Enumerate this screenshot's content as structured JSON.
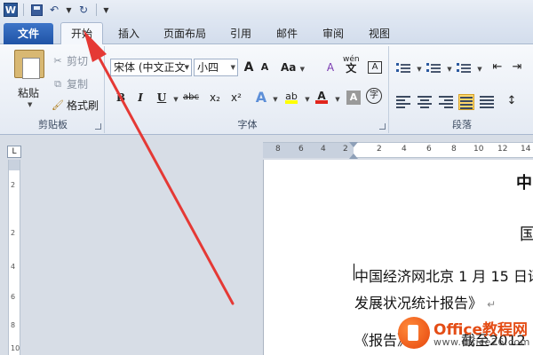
{
  "quick_access": {
    "app_letter": "W"
  },
  "tabs": {
    "file": "文件",
    "home": "开始",
    "insert": "插入",
    "page_layout": "页面布局",
    "references": "引用",
    "mailings": "邮件",
    "review": "审阅",
    "view": "视图"
  },
  "clipboard": {
    "paste": "粘贴",
    "cut": "剪切",
    "copy": "复制",
    "format_painter": "格式刷",
    "group_label": "剪贴板"
  },
  "font": {
    "font_name": "宋体 (中文正文",
    "font_size": "小四",
    "grow": "A",
    "shrink": "A",
    "change_case": "Aa",
    "clear_format": "A",
    "phonetic": "wén",
    "char_border": "A",
    "bold": "B",
    "italic": "I",
    "underline": "U",
    "strike": "abc",
    "subscript": "x₂",
    "superscript": "x²",
    "text_effect": "A",
    "highlight": "ab",
    "font_color": "A",
    "char_shading": "A",
    "enclose_char": "字",
    "group_label": "字体"
  },
  "paragraph": {
    "group_label": "段落"
  },
  "ruler": {
    "ticks": [
      "8",
      "6",
      "4",
      "2",
      "2",
      "4",
      "6",
      "8",
      "10",
      "12",
      "14"
    ],
    "vticks": [
      "2",
      "2",
      "4",
      "6",
      "8",
      "10"
    ]
  },
  "document": {
    "heading_char": "中",
    "second_char": "国",
    "line1": "中国经济网北京 1 月 15 日讯",
    "line2": "发展状况统计报告》",
    "paragraph_mark": "↵",
    "line3_start": "《报告》",
    "line3_end": "截至2012"
  },
  "watermark": {
    "brand": "Office教程网",
    "url": "www.office26.com"
  },
  "colors": {
    "file_tab": "#2b5fb4",
    "arrow": "#e53935",
    "highlight": "#ffff00",
    "font_color": "#e0241c"
  }
}
